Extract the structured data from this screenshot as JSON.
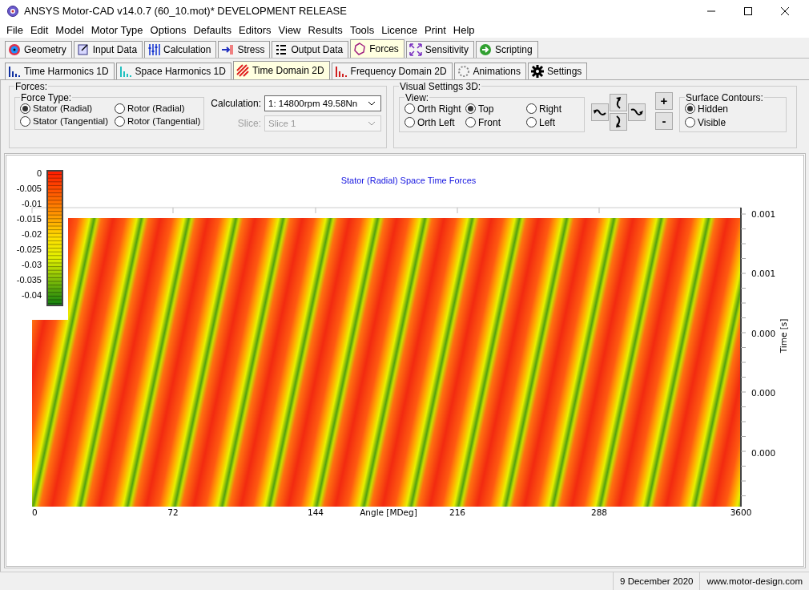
{
  "window": {
    "title": "ANSYS Motor-CAD v14.0.7 (60_10.mot)* DEVELOPMENT RELEASE"
  },
  "menu": [
    "File",
    "Edit",
    "Model",
    "Motor Type",
    "Options",
    "Defaults",
    "Editors",
    "View",
    "Results",
    "Tools",
    "Licence",
    "Print",
    "Help"
  ],
  "main_tabs": [
    {
      "label": "Geometry",
      "selected": false
    },
    {
      "label": "Input Data",
      "selected": false
    },
    {
      "label": "Calculation",
      "selected": false
    },
    {
      "label": "Stress",
      "selected": false
    },
    {
      "label": "Output Data",
      "selected": false
    },
    {
      "label": "Forces",
      "selected": true
    },
    {
      "label": "Sensitivity",
      "selected": false
    },
    {
      "label": "Scripting",
      "selected": false
    }
  ],
  "sub_tabs": [
    {
      "label": "Time Harmonics 1D",
      "selected": false
    },
    {
      "label": "Space Harmonics 1D",
      "selected": false
    },
    {
      "label": "Time Domain 2D",
      "selected": true
    },
    {
      "label": "Frequency Domain 2D",
      "selected": false
    },
    {
      "label": "Animations",
      "selected": false
    },
    {
      "label": "Settings",
      "selected": false
    }
  ],
  "forces": {
    "title": "Forces:",
    "force_type": {
      "title": "Force Type:",
      "options": [
        {
          "label": "Stator (Radial)",
          "selected": true
        },
        {
          "label": "Rotor (Radial)",
          "selected": false
        },
        {
          "label": "Stator (Tangential)",
          "selected": false
        },
        {
          "label": "Rotor (Tangential)",
          "selected": false
        }
      ]
    },
    "calculation": {
      "label": "Calculation:",
      "value": "1:  14800rpm  49.58Nn",
      "disabled": false
    },
    "slice": {
      "label": "Slice:",
      "value": "Slice 1",
      "disabled": true
    }
  },
  "visual_settings": {
    "title": "Visual Settings 3D:",
    "view": {
      "title": "View:",
      "options": [
        {
          "label": "Orth Right",
          "selected": false
        },
        {
          "label": "Top",
          "selected": true
        },
        {
          "label": "Right",
          "selected": false
        },
        {
          "label": "Orth Left",
          "selected": false
        },
        {
          "label": "Front",
          "selected": false
        },
        {
          "label": "Left",
          "selected": false
        }
      ]
    },
    "zoom_buttons": [
      "+",
      "-"
    ],
    "surface_contours": {
      "title": "Surface Contours:",
      "options": [
        {
          "label": "Hidden",
          "selected": true
        },
        {
          "label": "Visible",
          "selected": false
        }
      ]
    }
  },
  "plot": {
    "title": "Stator (Radial) Space Time Forces",
    "colorbar_ticks": [
      "0",
      "-0.005",
      "-0.01",
      "-0.015",
      "-0.02",
      "-0.025",
      "-0.03",
      "-0.035",
      "-0.04"
    ],
    "y_ticks": [
      "0.001",
      "0.001",
      "0.000",
      "0.000",
      "0.000"
    ],
    "y_label": "Time [s]",
    "x_ticks": [
      "0",
      "72",
      "144",
      "216",
      "288",
      "3600"
    ],
    "x_label": "Angle [MDeg]"
  },
  "status_bar": {
    "date": "9 December 2020",
    "website": "www.motor-design.com"
  }
}
